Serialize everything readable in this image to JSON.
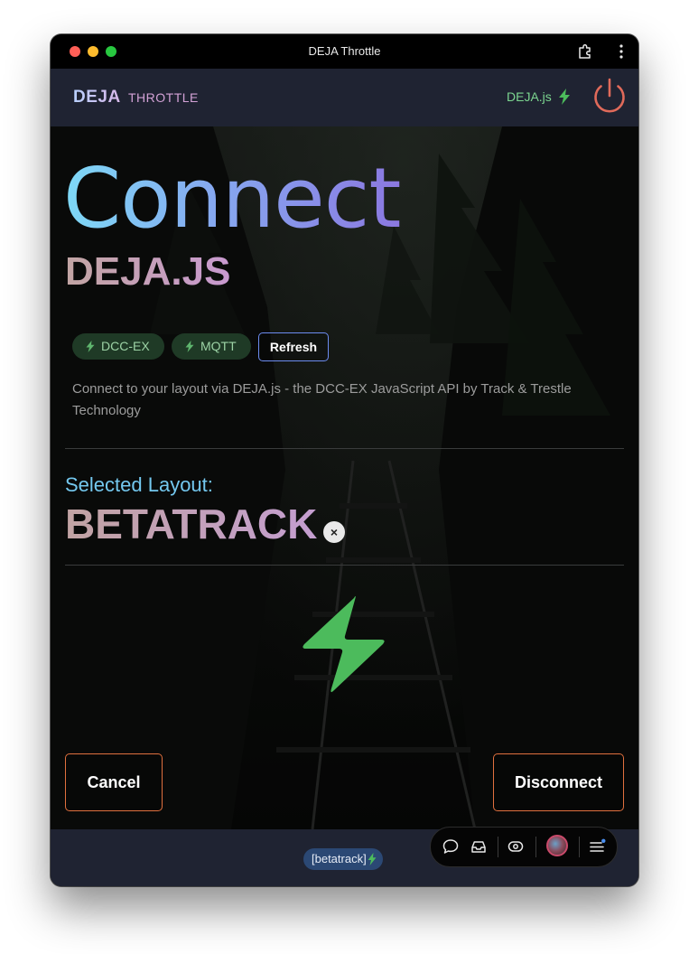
{
  "window": {
    "title": "DEJA Throttle"
  },
  "appbar": {
    "brand": "DEJA",
    "product": "THROTTLE",
    "api_link": "DEJA.js",
    "icons": [
      "bolt-icon",
      "power-icon"
    ]
  },
  "main": {
    "title": "Connect",
    "subtitle": "DEJA.JS",
    "chips": [
      {
        "label": "DCC-EX",
        "icon": "bolt-icon"
      },
      {
        "label": "MQTT",
        "icon": "bolt-icon"
      }
    ],
    "refresh_label": "Refresh",
    "description": "Connect to your layout via DEJA.js - the DCC-EX JavaScript API by Track & Trestle Technology",
    "selected_label": "Selected Layout:",
    "selected_layout": "BETATRACK",
    "clear_symbol": "×",
    "cancel_label": "Cancel",
    "disconnect_label": "Disconnect"
  },
  "footer": {
    "layout_chip": "[betatrack]",
    "dock_icons": [
      "chat-icon",
      "inbox-icon",
      "eye-icon",
      "avatar",
      "menu-icon"
    ]
  },
  "colors": {
    "accent_green": "#4cbb5c",
    "power_red": "#e06a5a",
    "button_border": "#e0703e",
    "refresh_border": "#6c8cf0",
    "appbar_bg": "#1f2332"
  }
}
